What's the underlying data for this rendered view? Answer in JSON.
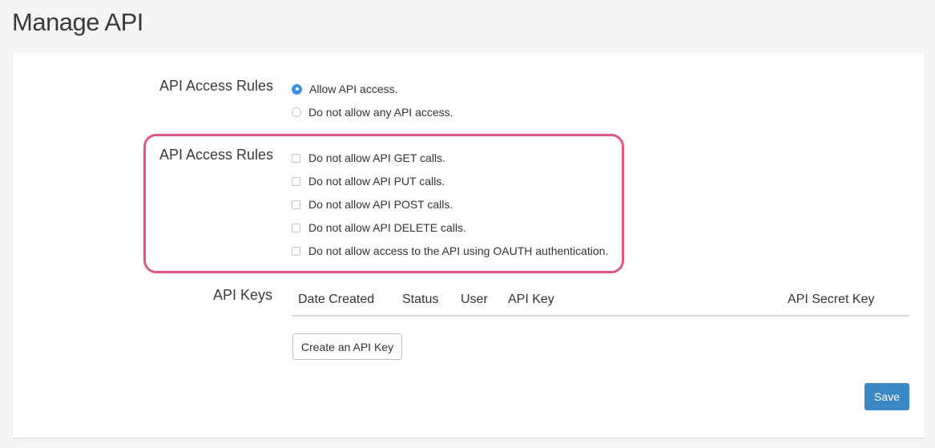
{
  "page": {
    "title": "Manage API"
  },
  "access_rules": {
    "label": "API Access Rules",
    "options": [
      {
        "label": "Allow API access.",
        "checked": true
      },
      {
        "label": "Do not allow any API access.",
        "checked": false
      }
    ]
  },
  "call_rules": {
    "label": "API Access Rules",
    "options": [
      {
        "label": "Do not allow API GET calls.",
        "checked": false
      },
      {
        "label": "Do not allow API PUT calls.",
        "checked": false
      },
      {
        "label": "Do not allow API POST calls.",
        "checked": false
      },
      {
        "label": "Do not allow API DELETE calls.",
        "checked": false
      },
      {
        "label": "Do not allow access to the API using OAUTH authentication.",
        "checked": false
      }
    ]
  },
  "api_keys": {
    "label": "API Keys",
    "columns": [
      "Date Created",
      "Status",
      "User",
      "API Key",
      "API Secret Key"
    ],
    "rows": [],
    "create_button": "Create an API Key"
  },
  "actions": {
    "save_label": "Save"
  },
  "colors": {
    "accent_radio": "#3d8ee6",
    "save_button": "#3b87c4",
    "highlight": "#e0587f"
  }
}
